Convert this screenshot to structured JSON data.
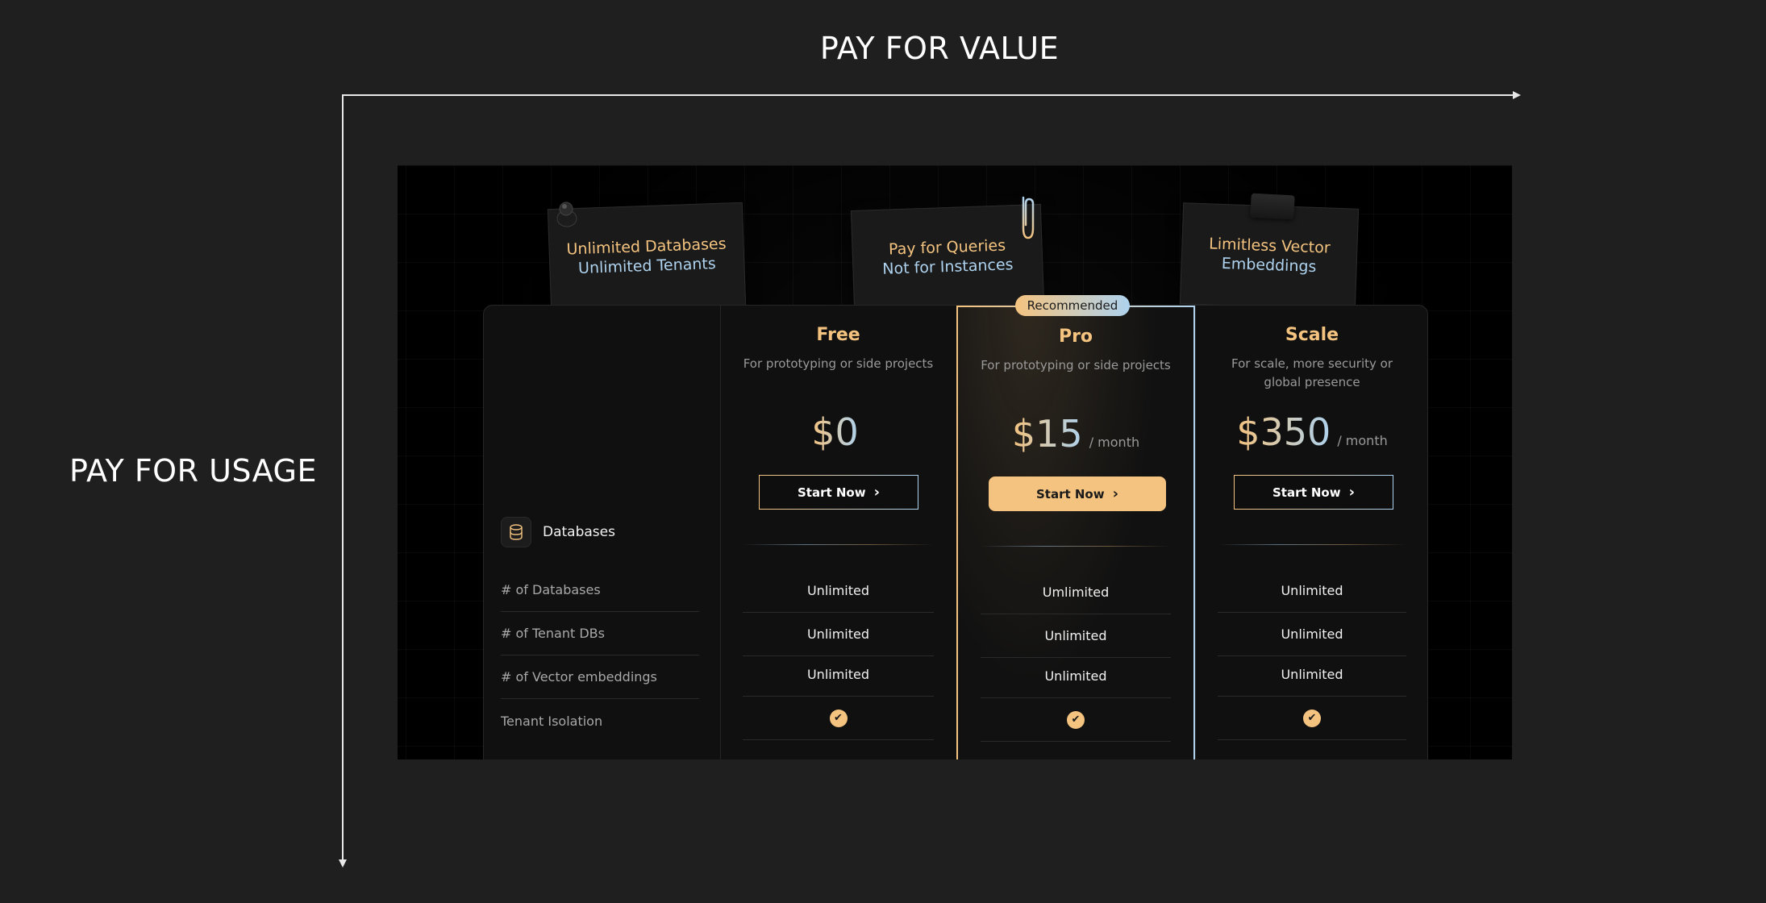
{
  "axis": {
    "top_title": "PAY FOR VALUE",
    "left_title": "PAY FOR USAGE"
  },
  "notes": [
    {
      "line1": "Unlimited Databases",
      "line2": "Unlimited Tenants"
    },
    {
      "line1": "Pay for Queries",
      "line2": "Not for Instances"
    },
    {
      "line1": "Limitless Vector",
      "line2": "Embeddings"
    }
  ],
  "recommended_badge": "Recommended",
  "feature_section": {
    "title": "Databases",
    "icon": "database-icon"
  },
  "rows": [
    "# of Databases",
    "# of Tenant DBs",
    "# of Vector embeddings",
    "Tenant Isolation"
  ],
  "plans": [
    {
      "name": "Free",
      "desc": "For prototyping or side projects",
      "price": "$0",
      "unit": "",
      "cta": "Start Now",
      "values": [
        "Unlimited",
        "Unlimited",
        "Unlimited"
      ]
    },
    {
      "name": "Pro",
      "desc": "For prototyping or side projects",
      "price": "$15",
      "unit": "/ month",
      "cta": "Start Now",
      "values": [
        "Umlimited",
        "Unlimited",
        "Unlimited"
      ]
    },
    {
      "name": "Scale",
      "desc": "For scale, more security or global presence",
      "price": "$350",
      "unit": "/ month",
      "cta": "Start Now",
      "values": [
        "Unlimited",
        "Unlimited",
        "Unlimited"
      ]
    }
  ],
  "colors": {
    "accent_peach": "#f4c37f",
    "accent_blue": "#aed2ee",
    "background": "#1f1f1f"
  }
}
